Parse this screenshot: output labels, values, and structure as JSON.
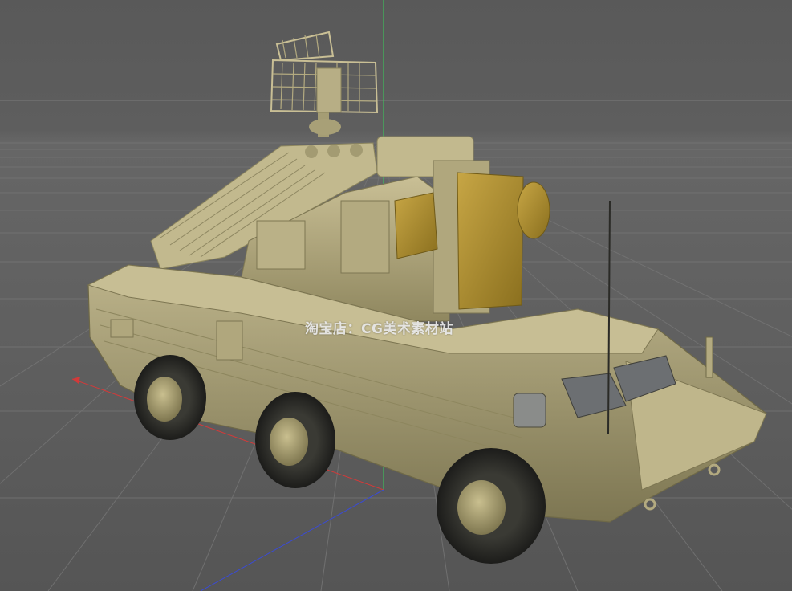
{
  "viewport": {
    "background_color": "#5b5b5b",
    "grid_color": "#6f6f6f",
    "axis_colors": {
      "x": "#d23a3a",
      "y": "#39d05a",
      "z": "#3a4bd6"
    },
    "model_color": "#b6ad84"
  },
  "watermark": {
    "text": "淘宝店：CG美术素材站"
  }
}
